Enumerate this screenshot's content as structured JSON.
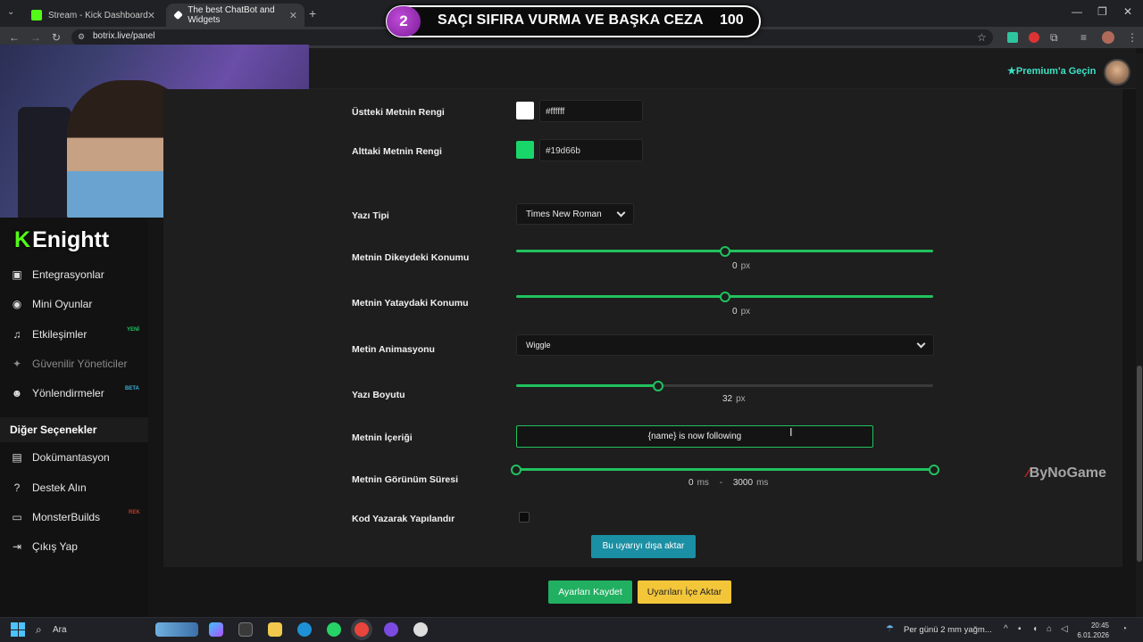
{
  "browser": {
    "tabs": [
      {
        "title": "Stream - Kick Dashboard",
        "favicon_color": "#53fc18"
      },
      {
        "title": "The best ChatBot and Widgets",
        "favicon_color": "#ffffff"
      }
    ],
    "url": "botrix.live/panel"
  },
  "stream_banner": {
    "number": "2",
    "text": "SAÇI SIFIRA VURMA VE BAŞKA CEZA",
    "count": "100"
  },
  "header": {
    "premium_label": "Premium'a Geçin",
    "premium_icon": "star-icon"
  },
  "overlay": {
    "channel_name": "Enightt",
    "watermark": "ByNoGame"
  },
  "sidebar": {
    "items": [
      {
        "label": "Entegrasyonlar",
        "icon": "integrations-icon",
        "badge": ""
      },
      {
        "label": "Mini Oyunlar",
        "icon": "gamepad-icon",
        "badge": ""
      },
      {
        "label": "Etkileşimler",
        "icon": "music-icon",
        "badge": "YENİ",
        "badge_color": "#21c25e"
      },
      {
        "label": "Güvenilir Yöneticiler",
        "icon": "users-icon",
        "badge": "",
        "disabled": true
      },
      {
        "label": "Yönlendirmeler",
        "icon": "group-icon",
        "badge": "BETA",
        "badge_color": "#3ab0d8"
      }
    ],
    "heading": "Diğer Seçenekler",
    "other_items": [
      {
        "label": "Dokümantasyon",
        "icon": "docs-icon",
        "badge": ""
      },
      {
        "label": "Destek Alın",
        "icon": "help-icon",
        "badge": ""
      },
      {
        "label": "MonsterBuilds",
        "icon": "monitor-icon",
        "badge": "REK",
        "badge_color": "#c0392b"
      },
      {
        "label": "Çıkış Yap",
        "icon": "logout-icon",
        "badge": ""
      }
    ]
  },
  "form": {
    "top_text_color": {
      "label": "Üstteki Metnin Rengi",
      "value": "#ffffff",
      "swatch": "#ffffff"
    },
    "bottom_text_color": {
      "label": "Alttaki Metnin Rengi",
      "value": "#19d66b",
      "swatch": "#19d66b"
    },
    "font": {
      "label": "Yazı Tipi",
      "value": "Times New Roman"
    },
    "vertical_position": {
      "label": "Metnin Dikeydeki Konumu",
      "value": "0",
      "unit": "px",
      "fraction": 0.5
    },
    "horizontal_position": {
      "label": "Metnin Yataydaki Konumu",
      "value": "0",
      "unit": "px",
      "fraction": 0.5
    },
    "animation": {
      "label": "Metin Animasyonu",
      "value": "Wiggle"
    },
    "font_size": {
      "label": "Yazı Boyutu",
      "value": "32",
      "unit": "px",
      "fraction": 0.34
    },
    "content": {
      "label": "Metnin İçeriği",
      "value": "{name} is now following"
    },
    "duration": {
      "label": "Metnin Görünüm Süresi",
      "min": "0",
      "max": "3000",
      "unit": "ms",
      "separator": "-"
    },
    "code_config": {
      "label": "Kod Yazarak Yapılandır",
      "checked": false
    },
    "export_label": "Bu uyarıyı dışa aktar"
  },
  "actions": {
    "save_label": "Ayarları Kaydet",
    "import_label": "Uyarıları İçe Aktar"
  },
  "taskbar": {
    "search_placeholder": "Ara",
    "weather": "Per günü 2 mm yağm...",
    "time": "20:45",
    "date": "6.01.2026"
  }
}
